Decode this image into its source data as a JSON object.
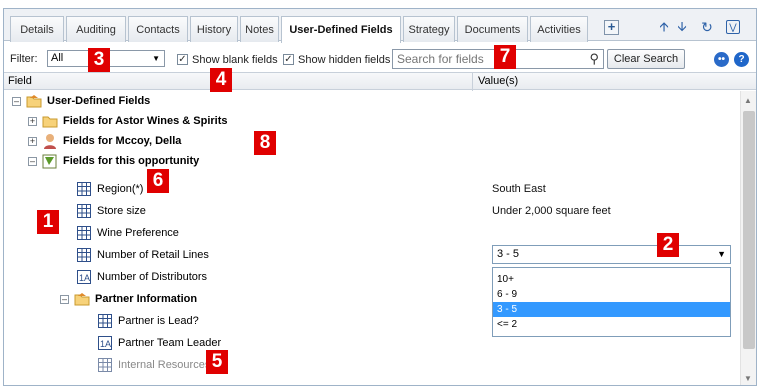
{
  "tabs": [
    {
      "label": "Details",
      "active": false
    },
    {
      "label": "Auditing",
      "active": false
    },
    {
      "label": "Contacts",
      "active": false
    },
    {
      "label": "History",
      "active": false
    },
    {
      "label": "Notes",
      "active": false
    },
    {
      "label": "User-Defined Fields",
      "active": true
    },
    {
      "label": "Strategy",
      "active": false
    },
    {
      "label": "Documents",
      "active": false
    },
    {
      "label": "Activities",
      "active": false
    }
  ],
  "toolbar": {
    "add_label": "+"
  },
  "filter": {
    "label": "Filter:",
    "value": "All",
    "show_blank_label": "Show blank fields",
    "show_blank_checked": true,
    "show_hidden_label": "Show hidden fields",
    "show_hidden_checked": true,
    "search_placeholder": "Search for fields",
    "clear_label": "Clear Search"
  },
  "columns": {
    "field": "Field",
    "values": "Value(s)"
  },
  "tree": {
    "root": "User-Defined Fields",
    "group_company": "Fields for Astor Wines & Spirits",
    "group_contact": "Fields for Mccoy, Della",
    "group_opportunity": "Fields for this opportunity",
    "fields": [
      {
        "label": "Region(*)",
        "value": "South East"
      },
      {
        "label": "Store size",
        "value": "Under 2,000 square feet"
      },
      {
        "label": "Wine Preference",
        "value": ""
      },
      {
        "label": "Number of Retail Lines",
        "value": ""
      },
      {
        "label": "Number of Distributors",
        "value": ""
      }
    ],
    "partner_group": "Partner Information",
    "partner_fields": [
      {
        "label": "Partner is Lead?"
      },
      {
        "label": "Partner Team Leader"
      },
      {
        "label": "Internal Resources"
      }
    ]
  },
  "retail_lines_dropdown": {
    "selected": "3 - 5",
    "options": [
      "10+",
      "6 - 9",
      "3 - 5",
      "<= 2"
    ],
    "highlighted_index": 2
  },
  "callouts": [
    "1",
    "2",
    "3",
    "4",
    "5",
    "6",
    "7",
    "8"
  ],
  "colors": {
    "callout": "#e00000",
    "highlight": "#3399ff",
    "accent": "#2e62a8"
  }
}
